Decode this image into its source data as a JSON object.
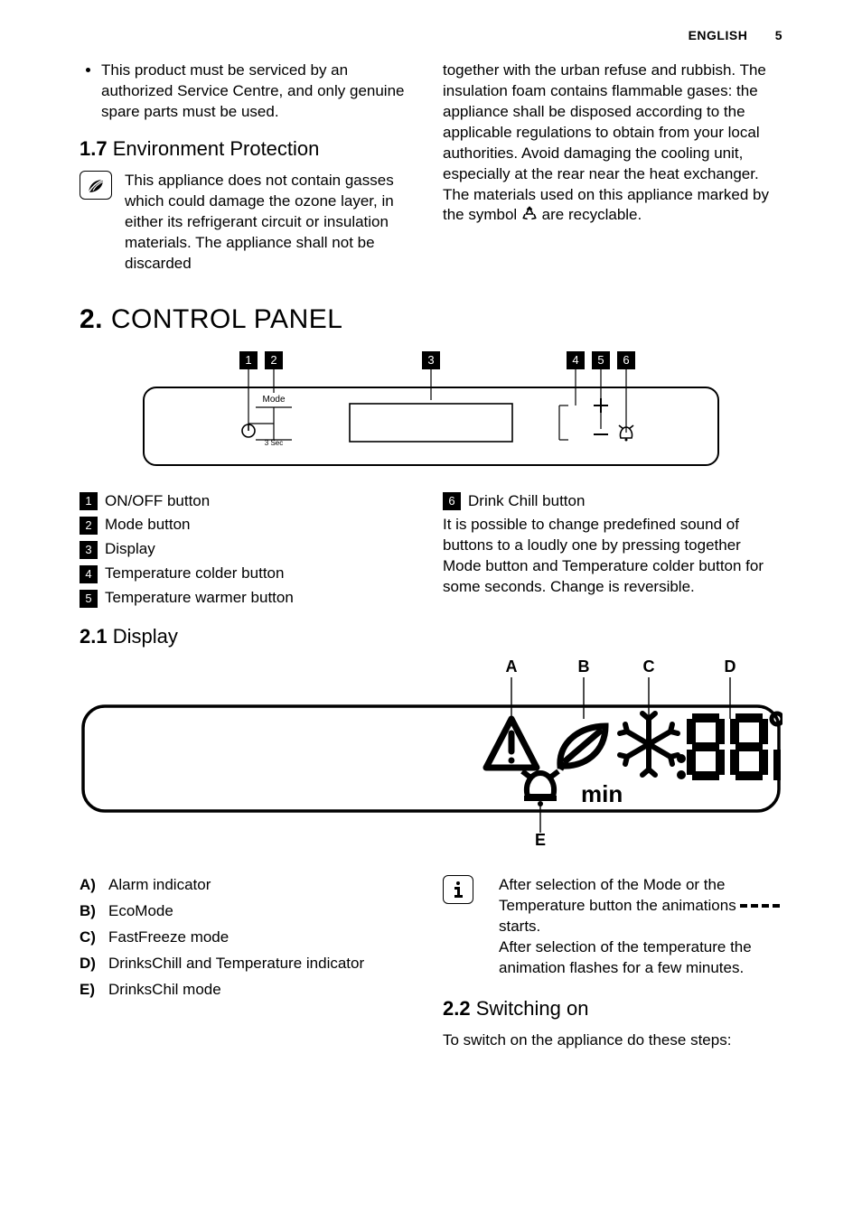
{
  "header": {
    "language": "ENGLISH",
    "page_number": "5"
  },
  "top": {
    "bullet": "This product must be serviced by an authorized Service Centre, and only genuine spare parts must be used.",
    "heading_num": "1.7",
    "heading_text": "Environment Protection",
    "col1_para": "This appliance does not contain gasses which could damage the ozone layer, in either its refrigerant circuit or insulation materials. The appliance shall not be discarded",
    "col2_para_a": "together with the urban refuse and rubbish. The insulation foam contains flammable gases: the appliance shall be disposed according to the applicable regulations to obtain from your local authorities. Avoid damaging the cooling unit, especially at the rear near the heat exchanger. The materials used on this appliance marked by the symbol ",
    "col2_para_b": " are recyclable."
  },
  "section2": {
    "heading_num": "2.",
    "heading_text": "CONTROL PANEL",
    "diagram": {
      "callout_nums": [
        "1",
        "2",
        "3",
        "4",
        "5",
        "6"
      ],
      "mode_label": "Mode",
      "timer_label": "3 Sec"
    },
    "callouts_left": [
      {
        "n": "1",
        "label": "ON/OFF button"
      },
      {
        "n": "2",
        "label": "Mode button"
      },
      {
        "n": "3",
        "label": "Display"
      },
      {
        "n": "4",
        "label": "Temperature colder button"
      },
      {
        "n": "5",
        "label": "Temperature warmer button"
      }
    ],
    "callout6": {
      "n": "6",
      "label": "Drink Chill button"
    },
    "right_para": "It is possible to change predefined sound of buttons to a loudly one by pressing together Mode button and Temperature colder button for some seconds. Change is reversible."
  },
  "section21": {
    "heading_num": "2.1",
    "heading_text": "Display",
    "letters": [
      "A",
      "B",
      "C",
      "D",
      "E"
    ],
    "min_label": "min",
    "list": [
      {
        "k": "A)",
        "v": "Alarm indicator"
      },
      {
        "k": "B)",
        "v": "EcoMode"
      },
      {
        "k": "C)",
        "v": "FastFreeze mode"
      },
      {
        "k": "D)",
        "v": "DrinksChill and Temperature indicator"
      },
      {
        "k": "E)",
        "v": "DrinksChil mode"
      }
    ],
    "info_a": "After selection of the Mode or the Temperature button the animations ",
    "info_b": " starts.",
    "info_c": "After selection of the temperature the animation flashes for a few minutes."
  },
  "section22": {
    "heading_num": "2.2",
    "heading_text": "Switching on",
    "para": "To switch on the appliance do these steps:"
  }
}
